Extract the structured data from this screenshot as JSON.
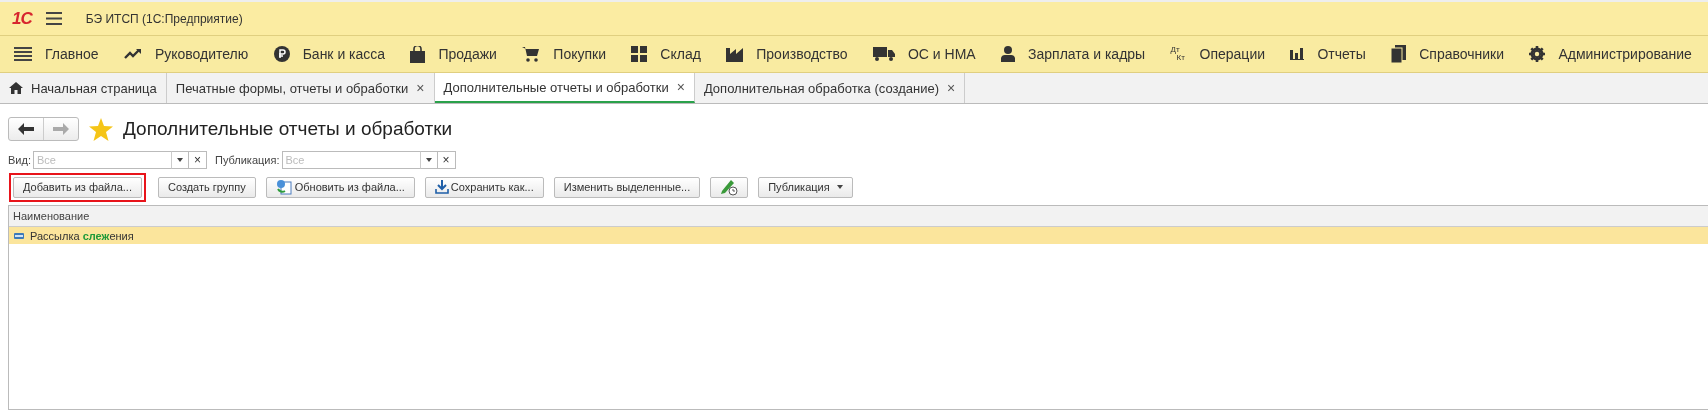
{
  "app_bar": {
    "logo": "1С",
    "title": "БЭ ИТСП  (1С:Предприятие)"
  },
  "sections": [
    {
      "label": "Главное"
    },
    {
      "label": "Руководителю"
    },
    {
      "label": "Банк и касса"
    },
    {
      "label": "Продажи"
    },
    {
      "label": "Покупки"
    },
    {
      "label": "Склад"
    },
    {
      "label": "Производство"
    },
    {
      "label": "ОС и НМА"
    },
    {
      "label": "Зарплата и кадры"
    },
    {
      "label": "Операции",
      "icon_text": [
        "Дт",
        "Кт"
      ]
    },
    {
      "label": "Отчеты"
    },
    {
      "label": "Справочники"
    },
    {
      "label": "Администрирование"
    }
  ],
  "tabs": [
    {
      "label": "Начальная страница",
      "selected": false,
      "kind": "home"
    },
    {
      "label": "Печатные формы, отчеты и обработки",
      "selected": false,
      "kind": "closable",
      "close": "×"
    },
    {
      "label": "Дополнительные отчеты и обработки",
      "selected": true,
      "kind": "closable",
      "close": "×"
    },
    {
      "label": "Дополнительная обработка (создание)",
      "selected": false,
      "kind": "closable",
      "close": "×"
    }
  ],
  "form": {
    "title": "Дополнительные отчеты и обработки",
    "favorite": true
  },
  "filters": [
    {
      "label": "Вид:",
      "placeholder": "Все",
      "clear": "×"
    },
    {
      "label": "Публикация:",
      "placeholder": "Все",
      "clear": "×"
    }
  ],
  "toolbar": [
    {
      "label": "Добавить из файла...",
      "kind": "text",
      "highlighted": true
    },
    {
      "label": "Создать группу",
      "kind": "text"
    },
    {
      "label": "Обновить из файла...",
      "kind": "refresh"
    },
    {
      "label": "Сохранить как...",
      "kind": "save"
    },
    {
      "label": "Изменить выделенные...",
      "kind": "text"
    },
    {
      "kind": "edit"
    },
    {
      "label": "Публикация",
      "kind": "dropdown"
    }
  ],
  "table": {
    "columns": [
      "Наименование"
    ],
    "rows": [
      {
        "name": "Рассылка **слеж**ения",
        "selected": true
      }
    ]
  }
}
